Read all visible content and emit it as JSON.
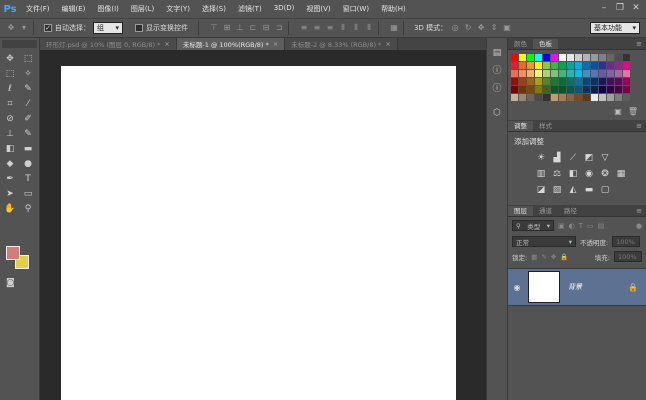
{
  "app": {
    "logo": "Ps"
  },
  "menu": [
    "文件(F)",
    "编辑(E)",
    "图像(I)",
    "图层(L)",
    "文字(Y)",
    "选择(S)",
    "滤镜(T)",
    "3D(D)",
    "视图(V)",
    "窗口(W)",
    "帮助(H)"
  ],
  "window_controls": {
    "minimize": "–",
    "restore": "❐",
    "close": "✕"
  },
  "options_bar": {
    "auto_select_label": "自动选择：",
    "auto_select_value": "组",
    "show_transform_label": "显示变换控件",
    "mode_3d_label": "3D 模式：",
    "workspace": "基本功能"
  },
  "tabs": [
    {
      "label": "环形灯.psd @ 10% (图层 0, RGB/8) *",
      "active": false
    },
    {
      "label": "未标题-1 @ 100%(RGB/8) *",
      "active": true
    },
    {
      "label": "未标题-2 @ 8.33% (RGB/8) *",
      "active": false
    }
  ],
  "swatch_colors": {
    "foreground": "#d37c7c",
    "background": "#e1d044"
  },
  "panels": {
    "color_tabs": [
      "颜色",
      "色板"
    ],
    "adjust_tabs": [
      "调整",
      "样式"
    ],
    "adjust_title": "添加调整",
    "layers_tabs": [
      "图层",
      "通道",
      "路径"
    ],
    "filter_kind": "类型",
    "blend_mode": "正常",
    "opacity_label": "不透明度:",
    "opacity_value": "100%",
    "lock_label": "锁定:",
    "fill_label": "填充:",
    "fill_value": "100%",
    "layer_name": "背景"
  }
}
